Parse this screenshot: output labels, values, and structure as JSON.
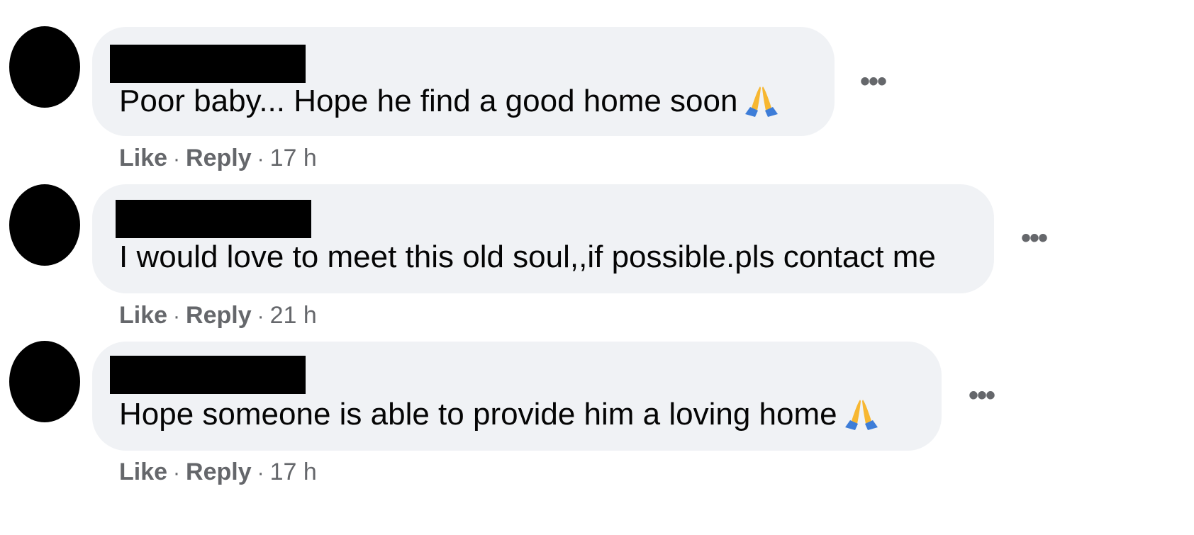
{
  "comments": [
    {
      "text": "Poor baby... Hope he find a good home soon",
      "emoji": "folded-hands",
      "like_label": "Like",
      "reply_label": "Reply",
      "separator": "·",
      "time": "17 h",
      "more_label": "•••"
    },
    {
      "text": "I would love to meet this old soul,,if possible.pls contact me",
      "emoji": "",
      "like_label": "Like",
      "reply_label": "Reply",
      "separator": "·",
      "time": "21 h",
      "more_label": "•••"
    },
    {
      "text": "Hope someone is able to provide him a loving home",
      "emoji": "folded-hands",
      "like_label": "Like",
      "reply_label": "Reply",
      "separator": "·",
      "time": "17 h",
      "more_label": "•••"
    }
  ],
  "colors": {
    "bubble": "#f0f2f5",
    "meta_text": "#65676b",
    "redaction": "#000000",
    "emoji_skin": "#f7b731",
    "emoji_sleeve": "#3d7dd8"
  }
}
